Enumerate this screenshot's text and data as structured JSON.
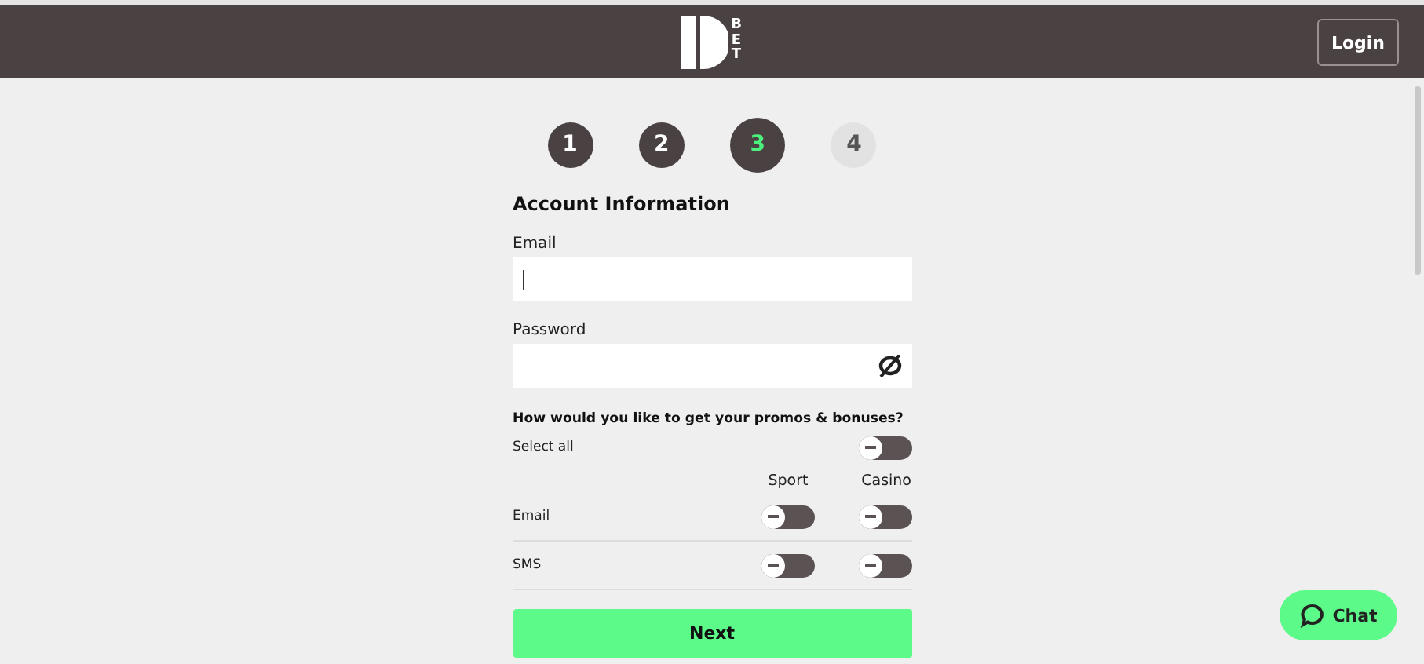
{
  "header": {
    "logo_text": "BET",
    "login_button": "Login"
  },
  "steps": [
    {
      "label": "1",
      "selected": false,
      "disabled": false
    },
    {
      "label": "2",
      "selected": false,
      "disabled": false
    },
    {
      "label": "3",
      "selected": true,
      "disabled": false
    },
    {
      "label": "4",
      "selected": false,
      "disabled": true
    }
  ],
  "form": {
    "title": "Account Information",
    "fields": [
      {
        "label": "Email",
        "kind": "text",
        "focused": true
      },
      {
        "label": "Password",
        "kind": "password",
        "focused": false
      }
    ],
    "promos": {
      "question": "How would you like to get your promos & bonuses?",
      "select_all": {
        "label": "Select all",
        "on": false
      },
      "columns": [
        "Sport",
        "Casino"
      ],
      "rows": [
        {
          "label": "Email",
          "toggles": [
            {
              "on": false
            },
            {
              "on": false
            }
          ]
        },
        {
          "label": "SMS",
          "toggles": [
            {
              "on": false
            },
            {
              "on": false
            }
          ]
        }
      ]
    },
    "next_button": "Next"
  },
  "chat_button": "Chat"
}
